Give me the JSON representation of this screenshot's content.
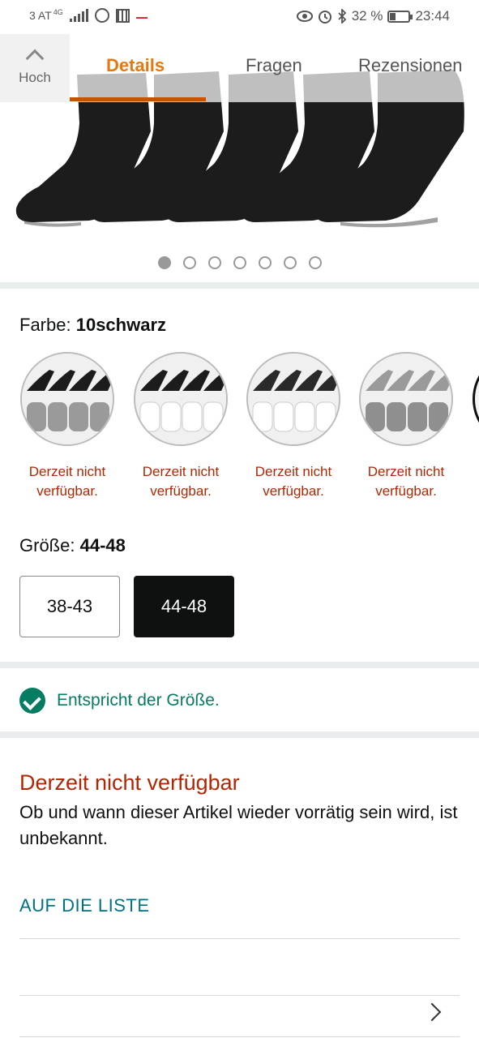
{
  "status_bar": {
    "carrier": "3 AT",
    "network": "4G",
    "battery": "32 %",
    "battery_level": 0.32,
    "time": "23:44"
  },
  "header": {
    "back_label": "Hoch",
    "tabs": [
      {
        "label": "Details",
        "active": true
      },
      {
        "label": "Fragen",
        "active": false
      },
      {
        "label": "Rezensionen",
        "active": false
      }
    ]
  },
  "gallery": {
    "image_count": 7,
    "active_index": 0
  },
  "color": {
    "label": "Farbe:",
    "value": "10schwarz",
    "options": [
      {
        "top": "black",
        "bottom": "gray",
        "status": "Derzeit nicht verfügbar."
      },
      {
        "top": "black",
        "bottom": "white",
        "status": "Derzeit nicht verfügbar."
      },
      {
        "top": "black",
        "bottom": "white",
        "status": "Derzeit nicht verfügbar."
      },
      {
        "top": "gray",
        "bottom": "gray",
        "status": "Derzeit nicht verfügbar."
      }
    ]
  },
  "size": {
    "label": "Größe:",
    "value": "44-48",
    "options": [
      {
        "label": "38-43",
        "selected": false
      },
      {
        "label": "44-48",
        "selected": true
      }
    ]
  },
  "fit": {
    "text": "Entspricht der Größe."
  },
  "availability": {
    "title": "Derzeit nicht verfügbar",
    "text": "Ob und wann dieser Artikel wieder vorrätig sein wird, ist unbekannt."
  },
  "list": {
    "add_label": "AUF DIE LISTE"
  },
  "colors": {
    "accent": "#e47911",
    "unavailable": "#b12704",
    "fit_green": "#067d62",
    "link": "#007185"
  }
}
